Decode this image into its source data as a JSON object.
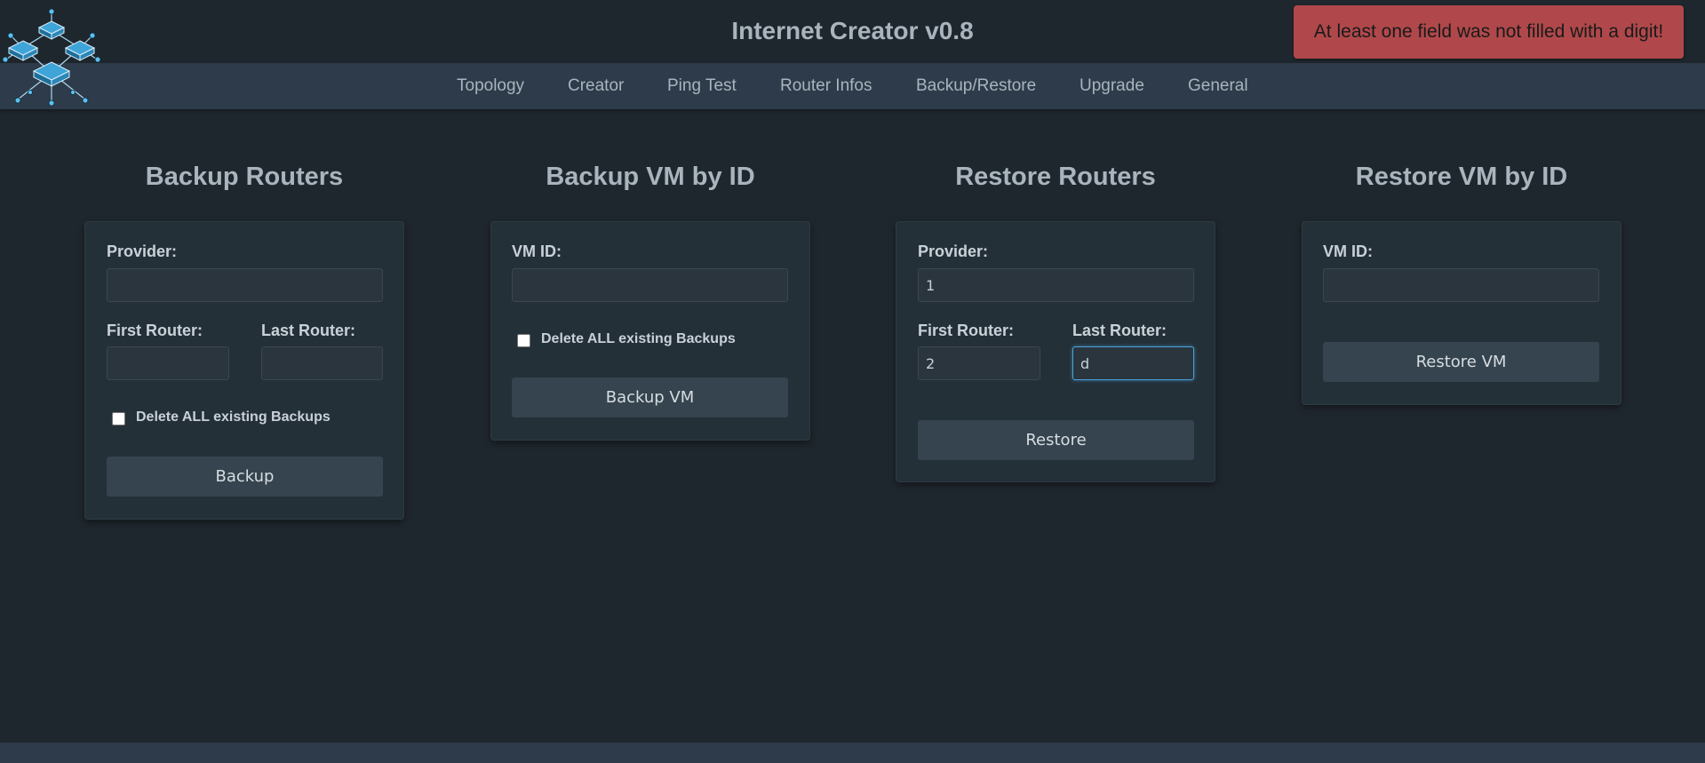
{
  "header": {
    "title": "Internet Creator v0.8",
    "alert": "At least one field was not filled with a digit!"
  },
  "nav": [
    {
      "label": "Topology"
    },
    {
      "label": "Creator"
    },
    {
      "label": "Ping Test"
    },
    {
      "label": "Router Infos"
    },
    {
      "label": "Backup/Restore"
    },
    {
      "label": "Upgrade"
    },
    {
      "label": "General"
    }
  ],
  "backup_routers": {
    "title": "Backup Routers",
    "provider_label": "Provider:",
    "provider_value": "",
    "first_label": "First Router:",
    "first_value": "",
    "last_label": "Last Router:",
    "last_value": "",
    "delete_label": "Delete ALL existing Backups",
    "button": "Backup"
  },
  "backup_vm": {
    "title": "Backup VM by ID",
    "vmid_label": "VM ID:",
    "vmid_value": "",
    "delete_label": "Delete ALL existing Backups",
    "button": "Backup VM"
  },
  "restore_routers": {
    "title": "Restore Routers",
    "provider_label": "Provider:",
    "provider_value": "1",
    "first_label": "First Router:",
    "first_value": "2",
    "last_label": "Last Router:",
    "last_value": "d",
    "button": "Restore"
  },
  "restore_vm": {
    "title": "Restore VM by ID",
    "vmid_label": "VM ID:",
    "vmid_value": "",
    "button": "Restore VM"
  },
  "colors": {
    "background": "#1f272e",
    "navbar": "#2d3b4a",
    "alert": "#b0484b",
    "button": "#35444e",
    "focus": "#4aa3df"
  }
}
